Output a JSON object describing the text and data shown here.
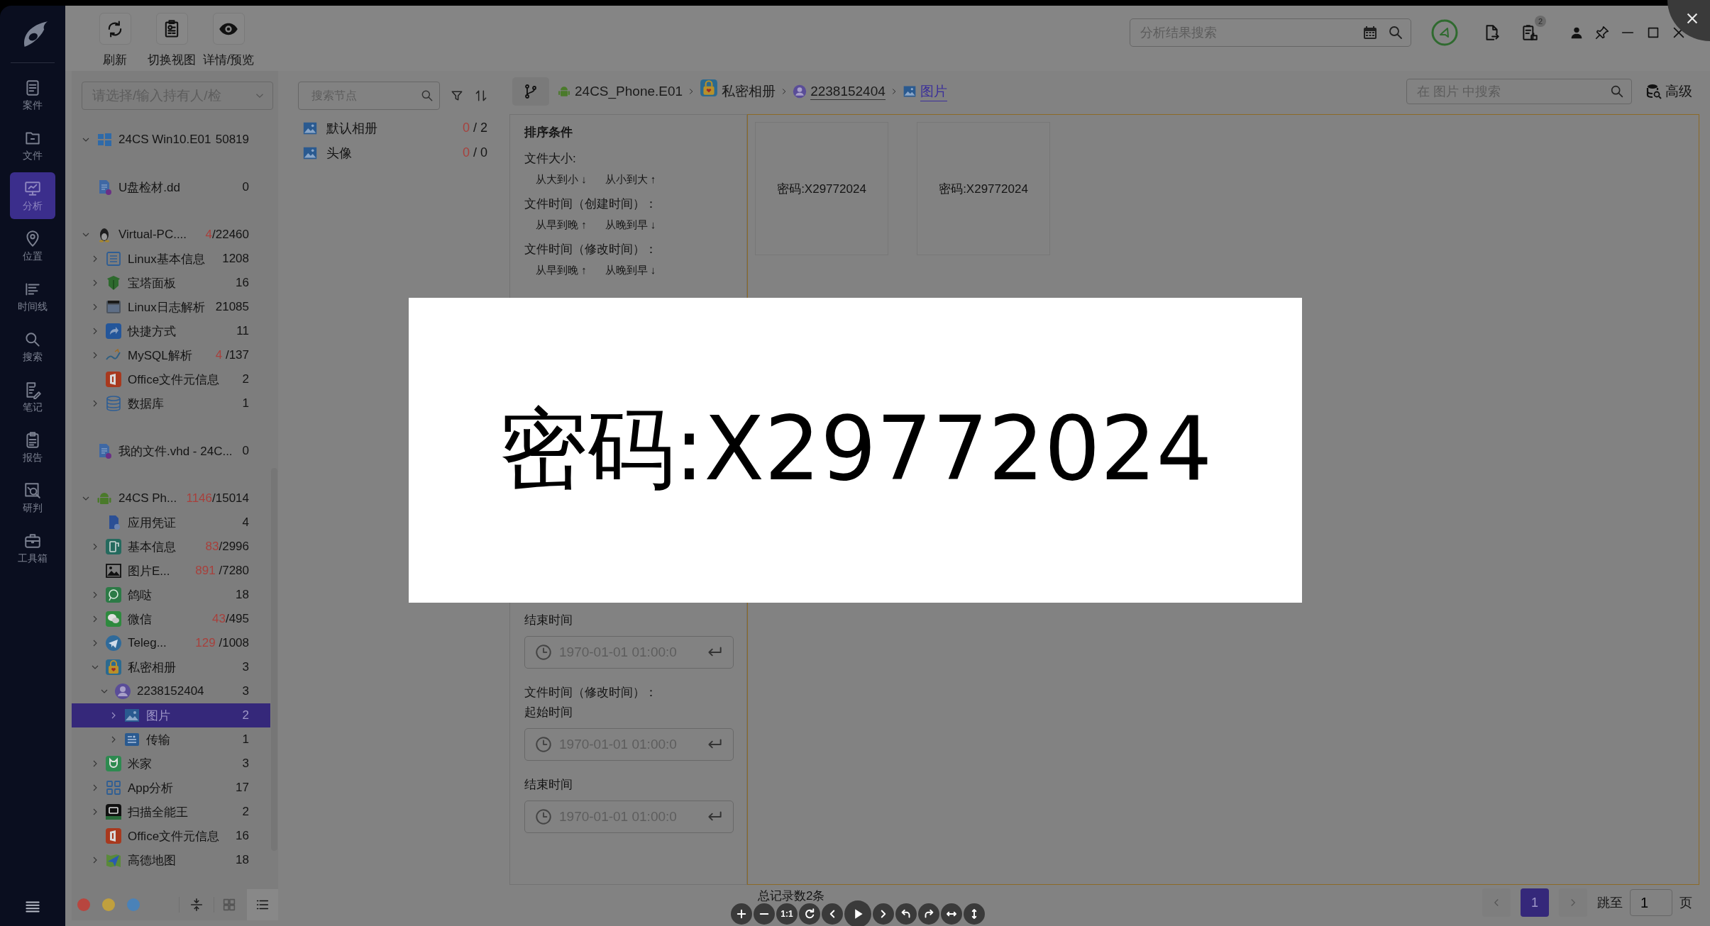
{
  "toolbar": {
    "buttons": [
      {
        "label": "刷新",
        "kind": "refresh"
      },
      {
        "label": "切换视图",
        "kind": "switch-view"
      },
      {
        "label": "详情/预览",
        "kind": "preview"
      }
    ]
  },
  "nav": {
    "items": [
      {
        "label": "案件",
        "kind": "case",
        "selected": false
      },
      {
        "label": "文件",
        "kind": "file",
        "selected": false
      },
      {
        "label": "分析",
        "kind": "analysis",
        "selected": true
      },
      {
        "label": "位置",
        "kind": "location",
        "selected": false
      },
      {
        "label": "时间线",
        "kind": "timeline",
        "selected": false
      },
      {
        "label": "搜索",
        "kind": "search",
        "selected": false
      },
      {
        "label": "笔记",
        "kind": "notes",
        "selected": false
      },
      {
        "label": "报告",
        "kind": "report",
        "selected": false
      },
      {
        "label": "研判",
        "kind": "judge",
        "selected": false
      },
      {
        "label": "工具箱",
        "kind": "toolbox",
        "selected": false
      }
    ]
  },
  "global_search": {
    "placeholder": "分析结果搜索"
  },
  "notification_badge": "2",
  "owner_select": {
    "placeholder": "请选择/输入持有人/检"
  },
  "tree": [
    {
      "label": "24CS Win10.E01",
      "kind": "windows",
      "count": "50819",
      "expanded": true,
      "selected": false
    },
    {
      "label": "U盘检材.dd",
      "kind": "document",
      "count": "0",
      "selected": false
    },
    {
      "label": "Virtual-PC....",
      "kind": "penguin",
      "hits": "4",
      "total": "/22460",
      "expanded": true,
      "selected": false,
      "children": [
        {
          "label": "Linux基本信息",
          "kind": "list",
          "count": "1208",
          "expanded": false,
          "selected": false
        },
        {
          "label": "宝塔面板",
          "kind": "shield",
          "count": "16",
          "expanded": false,
          "selected": false
        },
        {
          "label": "Linux日志解析",
          "kind": "log",
          "count": "21085",
          "expanded": false,
          "selected": false
        },
        {
          "label": "快捷方式",
          "kind": "shortcut",
          "count": "11",
          "expanded": false,
          "selected": false
        },
        {
          "label": "MySQL解析",
          "kind": "mysql",
          "hits": "4",
          "total": " /137",
          "expanded": false,
          "selected": false
        },
        {
          "label": "Office文件元信息",
          "kind": "office",
          "count": "2",
          "selected": false
        },
        {
          "label": "数据库",
          "kind": "database",
          "count": "1",
          "expanded": false,
          "selected": false
        }
      ]
    },
    {
      "label": "我的文件.vhd - 24C...",
      "kind": "document",
      "count": "0",
      "selected": false
    },
    {
      "label": "24CS Ph...",
      "kind": "android",
      "hits": "1146",
      "total": "/15014",
      "expanded": true,
      "selected": false,
      "children": [
        {
          "label": "应用凭证",
          "kind": "credential",
          "count": "4",
          "selected": false
        },
        {
          "label": "基本信息",
          "kind": "phone",
          "hits": "83",
          "total": "/2996",
          "expanded": false,
          "selected": false
        },
        {
          "label": "图片E...",
          "kind": "image",
          "hits": "891",
          "total": " /7280",
          "selected": false
        },
        {
          "label": "鸽哒",
          "kind": "chat",
          "count": "18",
          "expanded": false,
          "selected": false
        },
        {
          "label": "微信",
          "kind": "wechat",
          "hits": "43",
          "total": "/495",
          "expanded": false,
          "selected": false
        },
        {
          "label": "Teleg...",
          "kind": "telegram",
          "hits": "129",
          "total": " /1008",
          "expanded": false,
          "selected": false
        },
        {
          "label": "私密相册",
          "kind": "lock",
          "count": "3",
          "expanded": true,
          "selected": false,
          "children": [
            {
              "label": "2238152404",
              "kind": "user",
              "count": "3",
              "expanded": true,
              "selected": false,
              "children": [
                {
                  "label": "图片",
                  "kind": "picture",
                  "count": "2",
                  "expanded": false,
                  "selected": true
                },
                {
                  "label": "传输",
                  "kind": "transfer",
                  "count": "1",
                  "expanded": false,
                  "selected": false
                }
              ]
            }
          ]
        },
        {
          "label": "米家",
          "kind": "mijia",
          "count": "3",
          "expanded": false,
          "selected": false
        },
        {
          "label": "App分析",
          "kind": "apps",
          "count": "17",
          "expanded": false,
          "selected": false
        },
        {
          "label": "扫描全能王",
          "kind": "scanner",
          "count": "2",
          "expanded": false,
          "selected": false
        },
        {
          "label": "Office文件元信息",
          "kind": "office",
          "count": "16",
          "selected": false
        },
        {
          "label": "高德地图",
          "kind": "map",
          "count": "18",
          "expanded": false,
          "selected": false
        }
      ]
    }
  ],
  "tree_tools": {
    "tags": [
      {
        "color": "#b8463f"
      },
      {
        "color": "#c0a03e"
      },
      {
        "color": "#4a82b8"
      }
    ],
    "views": [
      {
        "kind": "grid",
        "selected": false
      },
      {
        "kind": "list",
        "selected": true
      }
    ]
  },
  "node_search": {
    "placeholder": "搜索节点"
  },
  "nodes": [
    {
      "label": "默认相册",
      "hits": "0",
      "total": " / 2"
    },
    {
      "label": "头像",
      "hits": "0",
      "total": " / 0"
    }
  ],
  "breadcrumb": [
    {
      "label": "24CS_Phone.E01",
      "kind": "android",
      "link": false,
      "current": false
    },
    {
      "label": "私密相册",
      "kind": "lock",
      "link": false,
      "current": false
    },
    {
      "label": "2238152404",
      "kind": "user",
      "link": true,
      "current": false
    },
    {
      "label": "图片",
      "kind": "picture",
      "link": true,
      "current": true
    }
  ],
  "scope_search": {
    "placeholder": "在 图片 中搜索"
  },
  "advanced": "高级",
  "sort": {
    "title": "排序条件",
    "groups": [
      {
        "label": "文件大小:",
        "options": [
          {
            "label": "从大到小",
            "arrow": "↓"
          },
          {
            "label": "从小到大",
            "arrow": "↑"
          }
        ]
      },
      {
        "label": "文件时间（创建时间）：",
        "options": [
          {
            "label": "从早到晚",
            "arrow": "↑"
          },
          {
            "label": "从晚到早",
            "arrow": "↓"
          }
        ]
      },
      {
        "label": "文件时间（修改时间）：",
        "options": [
          {
            "label": "从早到晚",
            "arrow": "↑"
          },
          {
            "label": "从晚到早",
            "arrow": "↓"
          }
        ]
      }
    ]
  },
  "filters": [
    {
      "kind": "label",
      "text": "结束时间"
    },
    {
      "kind": "field",
      "placeholder": "1970-01-01 01:00:0"
    },
    {
      "kind": "label",
      "text": "文件时间（修改时间）："
    },
    {
      "kind": "label",
      "text": "起始时间"
    },
    {
      "kind": "field",
      "placeholder": "1970-01-01 01:00:0"
    },
    {
      "kind": "label",
      "text": "结束时间"
    },
    {
      "kind": "field",
      "placeholder": "1970-01-01 01:00:0"
    }
  ],
  "thumbnails": [
    {
      "caption": "密码:X29772024"
    },
    {
      "caption": "密码:X29772024"
    }
  ],
  "pagination": {
    "total": "总记录数2条",
    "pages": [
      {
        "label": "1",
        "selected": true
      }
    ],
    "jump_label": "跳至",
    "jump_value": "1",
    "page_unit": "页"
  },
  "viewer": {
    "image_text": "密码:X29772024",
    "reset_label": "1:1"
  }
}
